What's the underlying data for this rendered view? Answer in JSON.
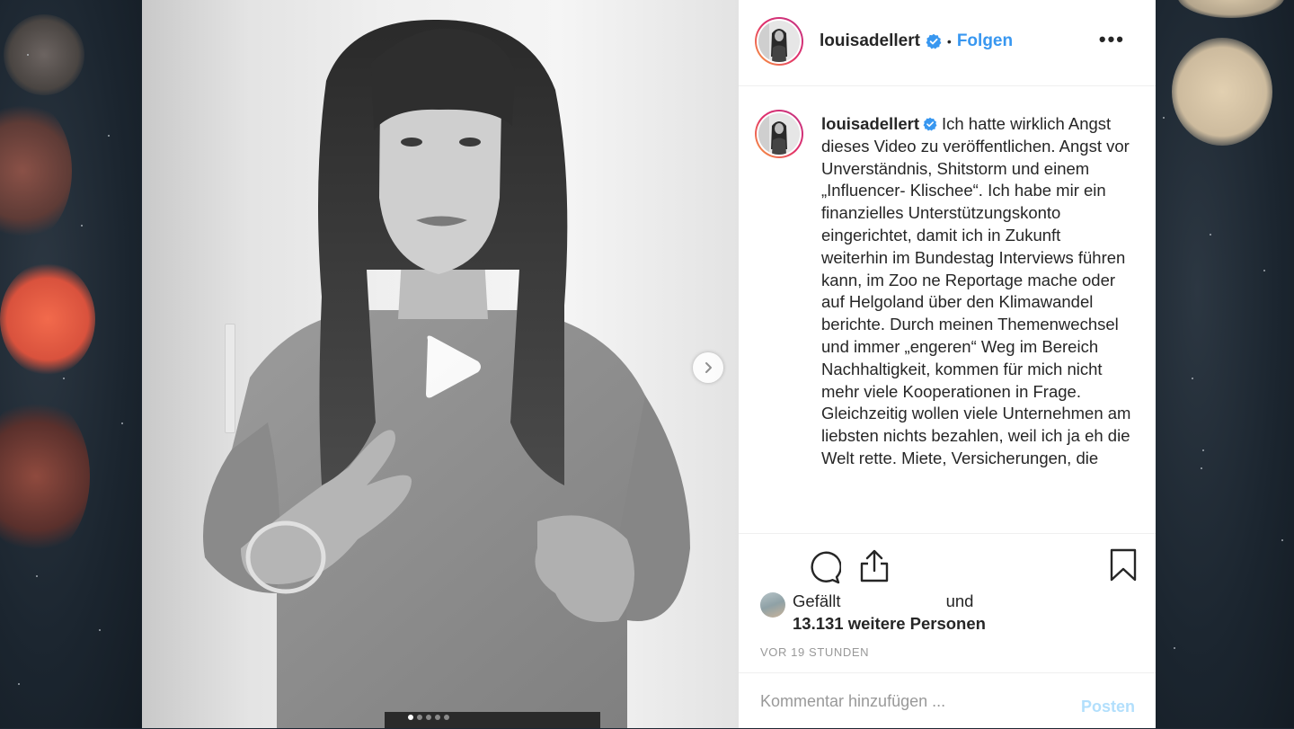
{
  "post": {
    "username": "louisadellert",
    "separator": "•",
    "follow_label": "Folgen",
    "more_label": "•••",
    "caption": "Ich hatte wirklich Angst dieses Video zu veröffentlichen. Angst vor Unverständnis, Shitstorm und einem „Influencer- Klischee“. Ich habe mir ein finanzielles Unterstützungskonto eingerichtet, damit ich in Zukunft weiterhin im Bundestag Interviews führen kann, im Zoo ne Reportage mache oder auf Helgoland über den Klimawandel berichte. Durch meinen Themenwechsel und immer „engeren“ Weg im Bereich Nachhaltigkeit, kommen für mich nicht mehr viele Kooperationen in Frage. Gleichzeitig wollen viele Unternehmen am liebsten nichts bezahlen, weil ich ja eh die Welt rette. Miete, Versicherungen, die",
    "likes_prefix": "Gefällt",
    "likes_conjunction": "und",
    "likes_count": "13.131 weitere Personen",
    "timestamp": "VOR 19 STUNDEN"
  },
  "comment": {
    "placeholder": "Kommentar hinzufügen ...",
    "post_label": "Posten"
  },
  "media": {
    "carousel_total": 5,
    "carousel_active": 1
  },
  "colors": {
    "accent": "#3897f0",
    "post_button_disabled": "#b2dffc",
    "text": "#262626",
    "muted": "#999999"
  },
  "icons": [
    "verified-badge-icon",
    "comment-icon",
    "share-icon",
    "bookmark-icon",
    "play-icon",
    "chevron-right-icon",
    "more-icon"
  ]
}
